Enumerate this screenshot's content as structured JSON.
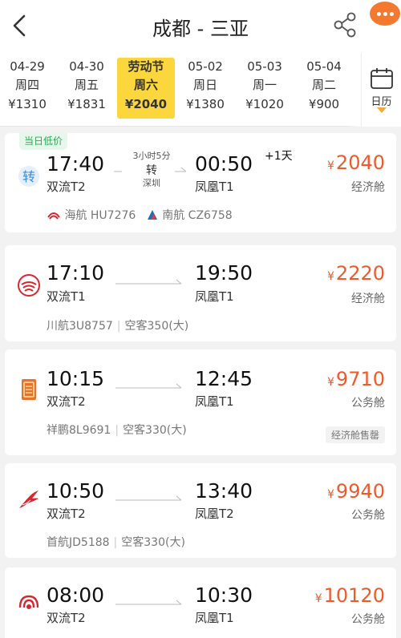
{
  "header": {
    "title": "成都 - 三亚"
  },
  "dates": [
    {
      "d1": "04-29",
      "d2": "周四",
      "price": "¥1310",
      "selected": false
    },
    {
      "d1": "04-30",
      "d2": "周五",
      "price": "¥1831",
      "selected": false
    },
    {
      "d1": "劳动节",
      "d2": "周六",
      "price": "¥2040",
      "selected": true
    },
    {
      "d1": "05-02",
      "d2": "周日",
      "price": "¥1380",
      "selected": false
    },
    {
      "d1": "05-03",
      "d2": "周一",
      "price": "¥1020",
      "selected": false
    },
    {
      "d1": "05-04",
      "d2": "周二",
      "price": "¥900",
      "selected": false
    }
  ],
  "calendar": {
    "label": "日历"
  },
  "currency": "¥",
  "flights": [
    {
      "badge": "当日低价",
      "dep_time": "17:40",
      "dep_airport": "双流T2",
      "arr_time": "00:50",
      "arr_airport": "凤凰T1",
      "next_day": "+1天",
      "transfer": {
        "duration": "3小时5分",
        "tag": "转",
        "city": "深圳"
      },
      "price": "2040",
      "cabin": "经济舱",
      "legs": [
        {
          "airline": "海航",
          "code": "HU7276"
        },
        {
          "airline": "南航",
          "code": "CZ6758"
        }
      ],
      "logo_icon": "transfer-icon"
    },
    {
      "dep_time": "17:10",
      "dep_airport": "双流T1",
      "arr_time": "19:50",
      "arr_airport": "凤凰T1",
      "price": "2220",
      "cabin": "经济舱",
      "flight_no": "川航3U8757",
      "aircraft": "空客350(大)",
      "logo_icon": "sichuan-airlines-icon"
    },
    {
      "dep_time": "10:15",
      "dep_airport": "双流T2",
      "arr_time": "12:45",
      "arr_airport": "凤凰T1",
      "price": "9710",
      "cabin": "公务舱",
      "flight_no": "祥鹏8L9691",
      "aircraft": "空客330(大)",
      "soldout": "经济舱售罄",
      "logo_icon": "lucky-air-icon"
    },
    {
      "dep_time": "10:50",
      "dep_airport": "双流T2",
      "arr_time": "13:40",
      "arr_airport": "凤凰T2",
      "price": "9940",
      "cabin": "公务舱",
      "flight_no": "首航JD5188",
      "aircraft": "空客330(大)",
      "logo_icon": "capital-airlines-icon"
    },
    {
      "dep_time": "08:00",
      "dep_airport": "双流T2",
      "arr_time": "10:30",
      "arr_airport": "凤凰T1",
      "price": "10120",
      "cabin": "公务舱",
      "logo_icon": "hainan-airlines-icon"
    }
  ],
  "colors": {
    "accent": "#f05a28",
    "selected_date": "#fbd63d",
    "badge_green": "#2cab57",
    "hainan_red": "#d7282f",
    "southern_blue": "#1d6dc3"
  }
}
